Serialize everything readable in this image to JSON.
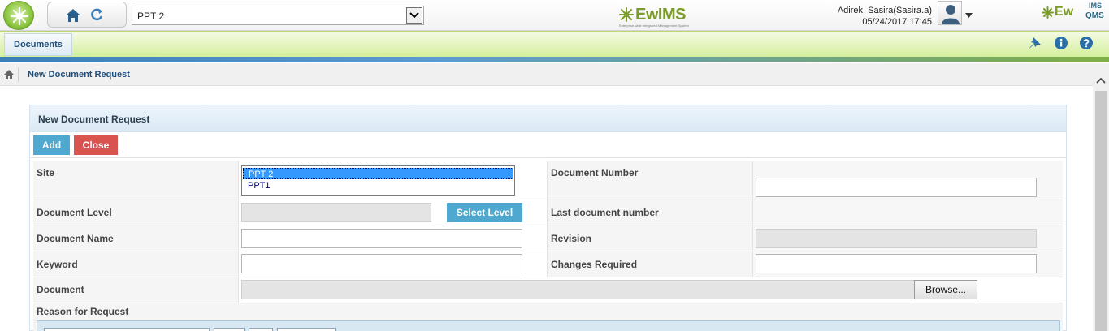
{
  "header": {
    "site_value": "PPT 2",
    "brand_center": "EwIMS",
    "brand_center_tagline": "Enterprise-wide Integrated Management System",
    "user_name": "Adirek, Sasira(Sasira.a)",
    "datetime": "05/24/2017 17:45",
    "brand_right": "Ew",
    "brand_right_sup": "IMS",
    "brand_right_sub": "QMS"
  },
  "menu": {
    "active_tab": "Documents",
    "icons": [
      "pin-icon",
      "info-icon",
      "help-icon"
    ]
  },
  "breadcrumb": {
    "label": "New Document Request"
  },
  "panel": {
    "title": "New Document Request",
    "add_label": "Add",
    "close_label": "Close"
  },
  "form": {
    "site_label": "Site",
    "site_options": [
      "PPT 2",
      "PPT1"
    ],
    "document_number_label": "Document Number",
    "document_number_value": "",
    "document_level_label": "Document Level",
    "select_level_label": "Select Level",
    "last_document_number_label": "Last document number",
    "document_name_label": "Document Name",
    "document_name_value": "",
    "revision_label": "Revision",
    "keyword_label": "Keyword",
    "keyword_value": "",
    "changes_required_label": "Changes Required",
    "changes_required_value": "",
    "document_label": "Document",
    "browse_label": "Browse...",
    "reason_label": "Reason for Request"
  },
  "colors": {
    "accent_blue": "#4fa8cf",
    "danger_red": "#d9534f",
    "menu_green": "#d4ef9c",
    "title_blue": "#1f4e79"
  }
}
